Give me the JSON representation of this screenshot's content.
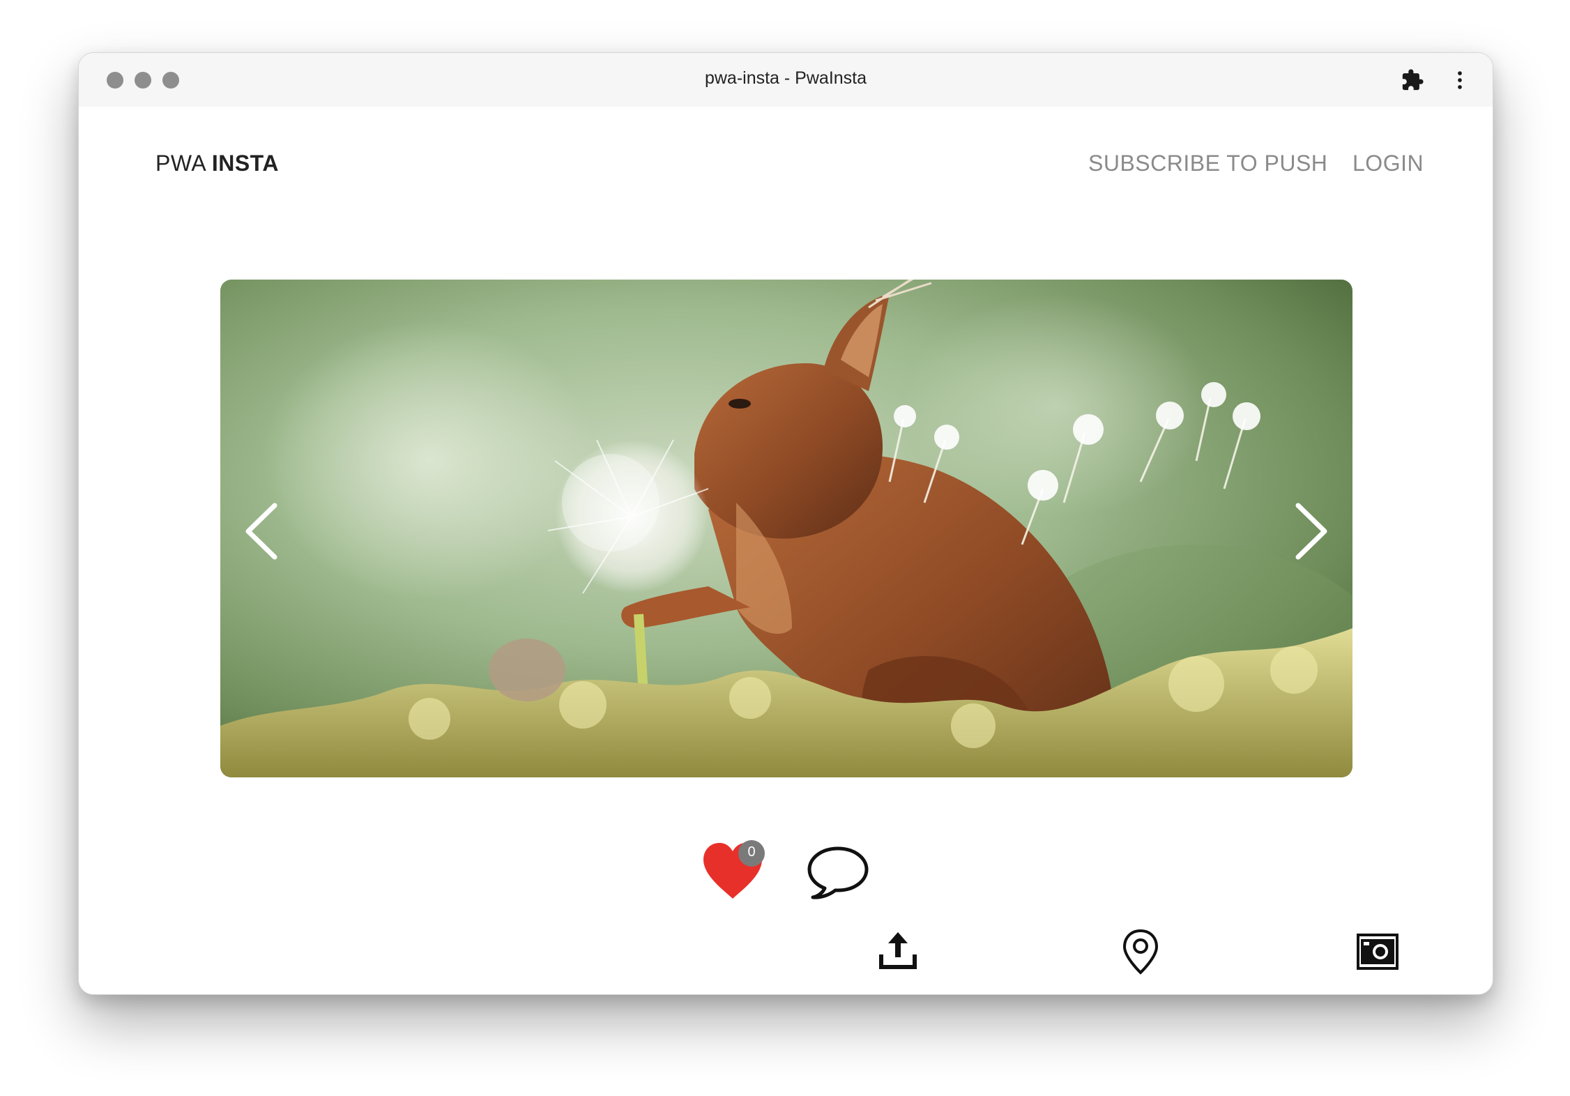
{
  "window": {
    "title": "pwa-insta - PwaInsta"
  },
  "header": {
    "brand_light": "PWA",
    "brand_bold": "INSTA",
    "nav": {
      "subscribe": "SUBSCRIBE TO PUSH",
      "login": "LOGIN"
    }
  },
  "carousel": {
    "image_alt": "squirrel-with-dandelion-photo",
    "prev_icon": "chevron-left-icon",
    "next_icon": "chevron-right-icon"
  },
  "post_actions": {
    "likes": "0",
    "like_icon": "heart-icon",
    "comment_icon": "speech-bubble-icon"
  },
  "toolbar": {
    "upload_icon": "upload-icon",
    "location_icon": "map-pin-icon",
    "camera_icon": "camera-icon"
  },
  "colors": {
    "like_red": "#e8302a",
    "badge_gray": "#7a7a7a",
    "nav_gray": "#8a8a8a"
  }
}
